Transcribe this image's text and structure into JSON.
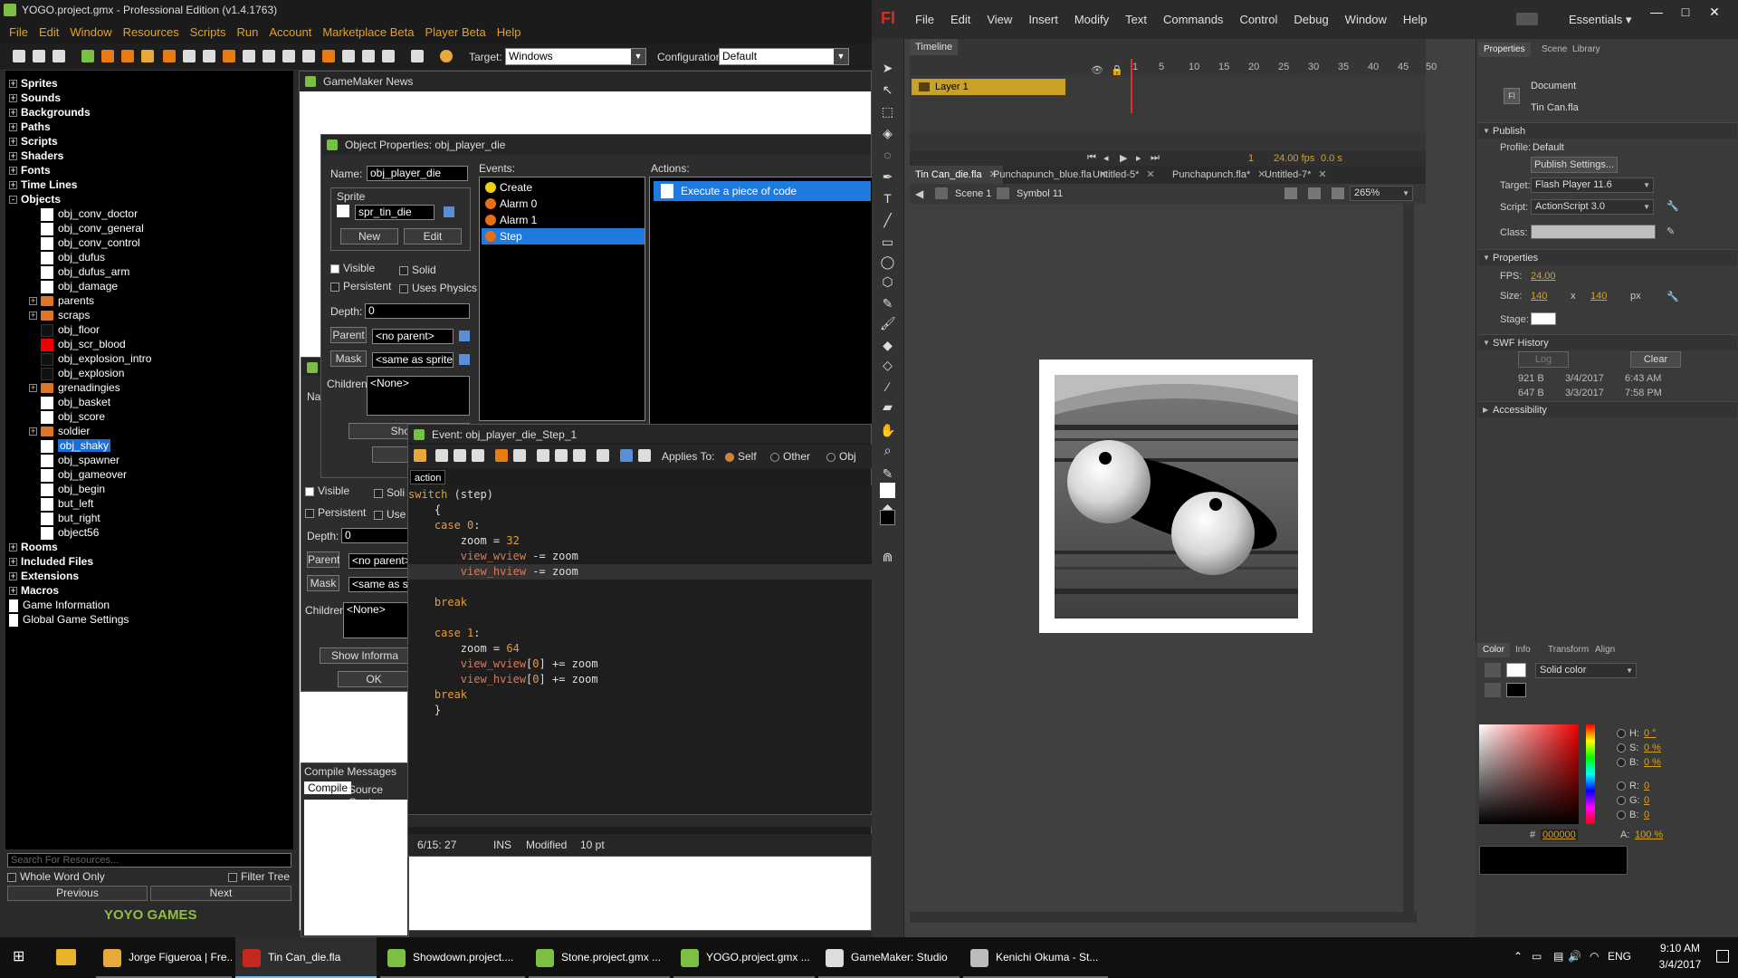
{
  "gm": {
    "title": "YOGO.project.gmx  -  Professional Edition (v1.4.1763)",
    "menu": [
      "File",
      "Edit",
      "Window",
      "Resources",
      "Scripts",
      "Run",
      "Account",
      "Marketplace Beta",
      "Player Beta",
      "Help"
    ],
    "target_label": "Target:",
    "target_value": "Windows",
    "config_label": "Configuration:",
    "config_value": "Default",
    "tree": [
      {
        "label": "Sprites",
        "bold": true,
        "pm": "+",
        "indent": 0,
        "kind": "folder"
      },
      {
        "label": "Sounds",
        "bold": true,
        "pm": "+",
        "indent": 0,
        "kind": "folder"
      },
      {
        "label": "Backgrounds",
        "bold": true,
        "pm": "+",
        "indent": 0,
        "kind": "folder"
      },
      {
        "label": "Paths",
        "bold": true,
        "pm": "+",
        "indent": 0,
        "kind": "folder"
      },
      {
        "label": "Scripts",
        "bold": true,
        "pm": "+",
        "indent": 0,
        "kind": "folder"
      },
      {
        "label": "Shaders",
        "bold": true,
        "pm": "+",
        "indent": 0,
        "kind": "folder"
      },
      {
        "label": "Fonts",
        "bold": true,
        "pm": "+",
        "indent": 0,
        "kind": "folder"
      },
      {
        "label": "Time Lines",
        "bold": true,
        "pm": "+",
        "indent": 0,
        "kind": "folder"
      },
      {
        "label": "Objects",
        "bold": true,
        "pm": "-",
        "indent": 0,
        "kind": "folder"
      },
      {
        "label": "obj_conv_doctor",
        "indent": 1,
        "kind": "obj"
      },
      {
        "label": "obj_conv_general",
        "indent": 1,
        "kind": "obj"
      },
      {
        "label": "obj_conv_control",
        "indent": 1,
        "kind": "obj"
      },
      {
        "label": "obj_dufus",
        "indent": 1,
        "kind": "obj"
      },
      {
        "label": "obj_dufus_arm",
        "indent": 1,
        "kind": "obj"
      },
      {
        "label": "obj_damage",
        "indent": 1,
        "kind": "obj"
      },
      {
        "label": "parents",
        "pm": "+",
        "indent": 1,
        "kind": "folder"
      },
      {
        "label": "scraps",
        "pm": "+",
        "indent": 1,
        "kind": "folder"
      },
      {
        "label": "obj_floor",
        "indent": 1,
        "kind": "black"
      },
      {
        "label": "obj_scr_blood",
        "indent": 1,
        "kind": "red"
      },
      {
        "label": "obj_explosion_intro",
        "indent": 1,
        "kind": "black"
      },
      {
        "label": "obj_explosion",
        "indent": 1,
        "kind": "black"
      },
      {
        "label": "grenadingies",
        "pm": "+",
        "indent": 1,
        "kind": "folder"
      },
      {
        "label": "obj_basket",
        "indent": 1,
        "kind": "obj"
      },
      {
        "label": "obj_score",
        "indent": 1,
        "kind": "obj"
      },
      {
        "label": "soldier",
        "pm": "+",
        "indent": 1,
        "kind": "folder"
      },
      {
        "label": "obj_shaky",
        "indent": 1,
        "kind": "obj",
        "selected": true
      },
      {
        "label": "obj_spawner",
        "indent": 1,
        "kind": "obj"
      },
      {
        "label": "obj_gameover",
        "indent": 1,
        "kind": "obj"
      },
      {
        "label": "obj_begin",
        "indent": 1,
        "kind": "obj"
      },
      {
        "label": "but_left",
        "indent": 1,
        "kind": "obj"
      },
      {
        "label": "but_right",
        "indent": 1,
        "kind": "obj"
      },
      {
        "label": "object56",
        "indent": 1,
        "kind": "obj"
      },
      {
        "label": "Rooms",
        "bold": true,
        "pm": "+",
        "indent": 0,
        "kind": "folder"
      },
      {
        "label": "Included Files",
        "bold": true,
        "pm": "+",
        "indent": 0,
        "kind": "folder"
      },
      {
        "label": "Extensions",
        "bold": true,
        "pm": "+",
        "indent": 0,
        "kind": "folder"
      },
      {
        "label": "Macros",
        "bold": true,
        "pm": "+",
        "indent": 0,
        "kind": "folder"
      },
      {
        "label": "Game Information",
        "indent": 0,
        "kind": "doc"
      },
      {
        "label": "Global Game Settings",
        "indent": 0,
        "kind": "doc"
      }
    ],
    "search_placeholder": "Search For Resources...",
    "whole_word": "Whole Word Only",
    "filter_tree": "Filter Tree",
    "previous": "Previous",
    "next": "Next",
    "logo": "YOYO GAMES",
    "news_title": "GameMaker News",
    "objprops": {
      "title": "Object Properties: obj_player_die",
      "name_label": "Name:",
      "name_value": "obj_player_die",
      "sprite_label": "Sprite",
      "sprite_value": "spr_tin_die",
      "new": "New",
      "edit": "Edit",
      "visible": "Visible",
      "solid": "Solid",
      "persistent": "Persistent",
      "uses_physics": "Uses Physics",
      "depth_label": "Depth:",
      "depth_value": "0",
      "parent": "Parent",
      "parent_value": "<no parent>",
      "mask": "Mask",
      "mask_value": "<same as sprite>",
      "children_label": "Children:",
      "children_value": "<None>",
      "events_label": "Events:",
      "events": [
        "Create",
        "Alarm 0",
        "Alarm 1",
        "Step"
      ],
      "actions_label": "Actions:",
      "action_item": "Execute a piece of code",
      "show_info": "Show Ir",
      "ok": "O"
    },
    "objprops2": {
      "na": "Na",
      "visible": "Visible",
      "solid": "Soli",
      "persistent": "Persistent",
      "use": "Use",
      "depth_label": "Depth:",
      "depth_value": "0",
      "parent": "Parent",
      "parent_value": "<no parent>",
      "mask": "Mask",
      "mask_value": "<same as sp",
      "children_label": "Children:",
      "children_value": "<None>",
      "show_info": "Show Informa",
      "ok": "OK"
    },
    "compile": {
      "title": "Compile Messages",
      "tab1": "Compile",
      "tab2": "Source Contr"
    },
    "event": {
      "title": "Event: obj_player_die_Step_1",
      "applies_to": "Applies To:",
      "self": "Self",
      "other": "Other",
      "obj": "Obj",
      "tab": "action",
      "code": [
        "switch (step)",
        "    {",
        "    case 0:",
        "        zoom = 32",
        "        view_wview -= zoom",
        "        view_hview -= zoom",
        "",
        "    break",
        "",
        "    case 1:",
        "        zoom = 64",
        "        view_wview[0] += zoom",
        "        view_hview[0] += zoom",
        "    break",
        "    }"
      ],
      "status_pos": "6/15: 27",
      "status_ins": "INS",
      "status_mod": "Modified",
      "status_pt": "10 pt"
    }
  },
  "flash": {
    "logo": "Fl",
    "menu": [
      "File",
      "Edit",
      "View",
      "Insert",
      "Modify",
      "Text",
      "Commands",
      "Control",
      "Debug",
      "Window",
      "Help"
    ],
    "workspace": "Essentials",
    "timeline_tab": "Timeline",
    "layer": "Layer 1",
    "frames": [
      "1",
      "5",
      "10",
      "15",
      "20",
      "25",
      "30",
      "35",
      "40",
      "45",
      "50"
    ],
    "fps": "24.00 fps",
    "time": "0.0 s",
    "frame": "1",
    "doc_tabs": [
      "Tin Can_die.fla",
      "Punchapunch_blue.fla",
      "Untitled-5*",
      "Punchapunch.fla*",
      "Untitled-7*"
    ],
    "scene": "Scene 1",
    "symbol": "Symbol 11",
    "zoom": "265%",
    "props": {
      "tabs": [
        "Properties",
        "Scene",
        "Library"
      ],
      "doc_type": "Document",
      "doc_name": "Tin Can.fla",
      "publish": "Publish",
      "profile_label": "Profile:",
      "profile_value": "Default",
      "publish_settings": "Publish Settings...",
      "target_label": "Target:",
      "target_value": "Flash Player 11.6",
      "script_label": "Script:",
      "script_value": "ActionScript 3.0",
      "class_label": "Class:",
      "properties": "Properties",
      "fps_label": "FPS:",
      "fps_value": "24.00",
      "size_label": "Size:",
      "size_w": "140",
      "size_x": "x",
      "size_h": "140",
      "size_unit": "px",
      "stage_label": "Stage:",
      "swf_history": "SWF History",
      "log": "Log",
      "clear": "Clear",
      "history": [
        {
          "size": "921 B",
          "date": "3/4/2017",
          "time": "6:43 AM"
        },
        {
          "size": "647 B",
          "date": "3/3/2017",
          "time": "7:58 PM"
        }
      ],
      "accessibility": "Accessibility"
    },
    "color": {
      "tabs": [
        "Color",
        "Info",
        "Transform",
        "Align"
      ],
      "mode": "Solid color",
      "h_label": "H:",
      "h_value": "0 °",
      "s_label": "S:",
      "s_value": "0 %",
      "b_label": "B:",
      "b_value": "0 %",
      "r_label": "R:",
      "r_value": "0",
      "g_label": "G:",
      "g_value": "0",
      "bb_label": "B:",
      "bb_value": "0",
      "hex_label": "#",
      "hex_value": "000000",
      "a_label": "A:",
      "a_value": "100 %"
    }
  },
  "taskbar": {
    "items": [
      {
        "label": "Jorge Figueroa | Fre...",
        "color": "#e8a93b"
      },
      {
        "label": "Tin Can_die.fla",
        "color": "#c5281c"
      },
      {
        "label": "Showdown.project....",
        "color": "#7bc043"
      },
      {
        "label": "Stone.project.gmx ...",
        "color": "#7bc043"
      },
      {
        "label": "YOGO.project.gmx ...",
        "color": "#7bc043"
      },
      {
        "label": "GameMaker: Studio",
        "color": "#dddddd"
      },
      {
        "label": "Kenichi Okuma - St...",
        "color": "#bbbbbb"
      }
    ],
    "lang": "ENG",
    "time": "9:10 AM",
    "date": "3/4/2017"
  }
}
